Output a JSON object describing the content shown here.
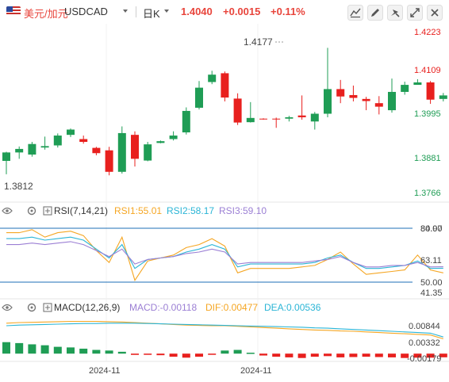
{
  "toolbar": {
    "symbol_name": "美元/加元",
    "symbol_code": "USDCAD",
    "period": "日K",
    "last_price": "1.4040",
    "change": "+0.0015",
    "change_pct": "+0.11%",
    "buttons": [
      "indicator-icon",
      "drawing-icon",
      "settings-icon",
      "fullscreen-icon",
      "close-icon"
    ]
  },
  "colors": {
    "up": "#1f9d55",
    "down": "#e8201e",
    "rsi1": "#f5a623",
    "rsi2": "#2bb5d6",
    "rsi3": "#9b7fd4",
    "macd_line": "#9b7fd4",
    "dif": "#f5a623",
    "dea": "#2bb5d6",
    "ref_line": "#1c6fb7"
  },
  "chart_data": [
    {
      "type": "candlestick",
      "name": "price",
      "y_ticks": [
        "1.4223",
        "1.4109",
        "1.3995",
        "1.3881",
        "1.3766"
      ],
      "ylim": [
        1.3766,
        1.4223
      ],
      "max_label": "1.4177",
      "min_label": "1.3812",
      "x_tick_labels": [
        "2024-11",
        "2024-11"
      ],
      "candles": [
        {
          "o": 1.3856,
          "h": 1.3882,
          "l": 1.3818,
          "c": 1.388
        },
        {
          "o": 1.388,
          "h": 1.3897,
          "l": 1.3862,
          "c": 1.389
        },
        {
          "o": 1.3874,
          "h": 1.391,
          "l": 1.3868,
          "c": 1.3904
        },
        {
          "o": 1.3894,
          "h": 1.3925,
          "l": 1.3888,
          "c": 1.3898
        },
        {
          "o": 1.39,
          "h": 1.3934,
          "l": 1.3894,
          "c": 1.3928
        },
        {
          "o": 1.393,
          "h": 1.3948,
          "l": 1.3924,
          "c": 1.3945
        },
        {
          "o": 1.3918,
          "h": 1.3928,
          "l": 1.3905,
          "c": 1.391
        },
        {
          "o": 1.3893,
          "h": 1.3896,
          "l": 1.3872,
          "c": 1.3878
        },
        {
          "o": 1.3886,
          "h": 1.3896,
          "l": 1.3815,
          "c": 1.3825
        },
        {
          "o": 1.3825,
          "h": 1.3954,
          "l": 1.382,
          "c": 1.3935
        },
        {
          "o": 1.393,
          "h": 1.394,
          "l": 1.384,
          "c": 1.3862
        },
        {
          "o": 1.3857,
          "h": 1.391,
          "l": 1.3855,
          "c": 1.3903
        },
        {
          "o": 1.3907,
          "h": 1.3914,
          "l": 1.3906,
          "c": 1.3912
        },
        {
          "o": 1.3918,
          "h": 1.394,
          "l": 1.3914,
          "c": 1.3928
        },
        {
          "o": 1.3937,
          "h": 1.4008,
          "l": 1.3931,
          "c": 1.3998
        },
        {
          "o": 1.4007,
          "h": 1.4083,
          "l": 1.4002,
          "c": 1.4064
        },
        {
          "o": 1.408,
          "h": 1.4112,
          "l": 1.4074,
          "c": 1.4101
        },
        {
          "o": 1.4105,
          "h": 1.411,
          "l": 1.4025,
          "c": 1.4036
        },
        {
          "o": 1.4033,
          "h": 1.4048,
          "l": 1.3958,
          "c": 1.3965
        },
        {
          "o": 1.3966,
          "h": 1.4023,
          "l": 1.3965,
          "c": 1.3978
        },
        {
          "o": 1.3976,
          "h": 1.3977,
          "l": 1.3973,
          "c": 1.3975
        },
        {
          "o": 1.3976,
          "h": 1.3979,
          "l": 1.395,
          "c": 1.3975
        },
        {
          "o": 1.3976,
          "h": 1.3984,
          "l": 1.3968,
          "c": 1.398
        },
        {
          "o": 1.3985,
          "h": 1.4042,
          "l": 1.3973,
          "c": 1.398
        },
        {
          "o": 1.3968,
          "h": 1.3995,
          "l": 1.3945,
          "c": 1.399
        },
        {
          "o": 1.399,
          "h": 1.4177,
          "l": 1.398,
          "c": 1.406
        },
        {
          "o": 1.406,
          "h": 1.4086,
          "l": 1.402,
          "c": 1.4039
        },
        {
          "o": 1.4043,
          "h": 1.407,
          "l": 1.4025,
          "c": 1.4035
        },
        {
          "o": 1.4032,
          "h": 1.4038,
          "l": 1.4,
          "c": 1.4026
        },
        {
          "o": 1.402,
          "h": 1.404,
          "l": 1.3988,
          "c": 1.401
        },
        {
          "o": 1.4,
          "h": 1.409,
          "l": 1.3993,
          "c": 1.4052
        },
        {
          "o": 1.4052,
          "h": 1.4081,
          "l": 1.4044,
          "c": 1.4072
        },
        {
          "o": 1.4072,
          "h": 1.4088,
          "l": 1.4073,
          "c": 1.4079
        },
        {
          "o": 1.4079,
          "h": 1.4083,
          "l": 1.4018,
          "c": 1.403
        },
        {
          "o": 1.4032,
          "h": 1.4049,
          "l": 1.4025,
          "c": 1.4042
        }
      ]
    },
    {
      "type": "line",
      "name": "RSI",
      "label": "RSI(7,14,21)",
      "values_text": {
        "rsi1": "RSI1:55.01",
        "rsi2": "RSI2:58.17",
        "rsi3": "RSI3:59.10"
      },
      "y_ticks": [
        "80.00",
        "84.97",
        "63.11",
        "50.00",
        "41.35"
      ],
      "ylim": [
        41.35,
        84.97
      ],
      "ref_lines": [
        80,
        50
      ],
      "series": [
        {
          "name": "RSI1",
          "values": [
            82,
            82,
            84,
            79,
            82,
            83,
            80,
            70,
            62,
            79,
            50,
            63,
            65,
            67,
            72,
            74,
            78,
            73,
            55,
            58,
            58,
            58,
            58,
            59,
            60,
            64,
            69,
            61,
            54,
            55,
            56,
            57,
            67,
            57,
            55.01
          ]
        },
        {
          "name": "RSI2",
          "values": [
            78,
            78,
            79,
            77,
            78,
            79,
            77,
            71,
            65,
            74,
            58,
            64,
            65,
            66,
            69,
            71,
            74,
            71,
            59,
            61,
            61,
            61,
            61,
            61,
            62,
            65,
            67,
            62,
            58,
            58,
            59,
            60,
            63,
            58,
            58.17
          ]
        },
        {
          "name": "RSI3",
          "values": [
            74,
            74,
            75,
            74,
            75,
            76,
            74,
            70,
            66,
            71,
            61,
            64,
            65,
            66,
            68,
            69,
            71,
            69,
            61,
            62,
            62,
            62,
            62,
            62,
            63,
            64,
            66,
            62,
            59,
            59,
            60,
            60,
            62,
            59,
            59.1
          ]
        }
      ]
    },
    {
      "type": "bar_line",
      "name": "MACD",
      "label": "MACD(12,26,9)",
      "values_text": {
        "macd": "MACD:-0.00118",
        "dif": "DIF:0.00477",
        "dea": "DEA:0.00536"
      },
      "y_ticks": [
        "0.00844",
        "0.00332",
        "-0.00179"
      ],
      "ylim": [
        -0.0025,
        0.0118
      ],
      "histogram": [
        0.0037,
        0.0034,
        0.003,
        0.0027,
        0.0022,
        0.002,
        0.0016,
        0.0012,
        0.001,
        0.0006,
        -0.0004,
        -0.0002,
        -0.0005,
        -0.001,
        -0.0013,
        -0.001,
        -0.0002,
        0.001,
        0.0012,
        0.0003,
        -0.0006,
        -0.001,
        -0.0012,
        -0.0014,
        -0.001,
        -0.0008,
        -0.0012,
        -0.0011,
        -0.001,
        -0.0011,
        -0.0012,
        -0.0014,
        -0.0013,
        -0.0013,
        -0.00118
      ],
      "series": [
        {
          "name": "DIF",
          "values": [
            0.0098,
            0.01,
            0.0101,
            0.0102,
            0.0103,
            0.0104,
            0.0104,
            0.0104,
            0.0103,
            0.0102,
            0.01,
            0.0098,
            0.0096,
            0.0094,
            0.0092,
            0.0091,
            0.009,
            0.009,
            0.0088,
            0.0086,
            0.0084,
            0.0082,
            0.008,
            0.0078,
            0.0076,
            0.0075,
            0.0073,
            0.0072,
            0.007,
            0.0068,
            0.0066,
            0.0064,
            0.0062,
            0.006,
            0.00477
          ]
        },
        {
          "name": "DEA",
          "values": [
            0.009,
            0.0092,
            0.0093,
            0.0094,
            0.0095,
            0.0096,
            0.0097,
            0.0097,
            0.0098,
            0.0098,
            0.0098,
            0.0097,
            0.0096,
            0.0095,
            0.0094,
            0.0093,
            0.0092,
            0.0091,
            0.009,
            0.0089,
            0.0088,
            0.0087,
            0.0086,
            0.0085,
            0.0083,
            0.0082,
            0.008,
            0.0078,
            0.0076,
            0.0074,
            0.0072,
            0.007,
            0.0068,
            0.0066,
            0.00536
          ]
        }
      ]
    }
  ]
}
